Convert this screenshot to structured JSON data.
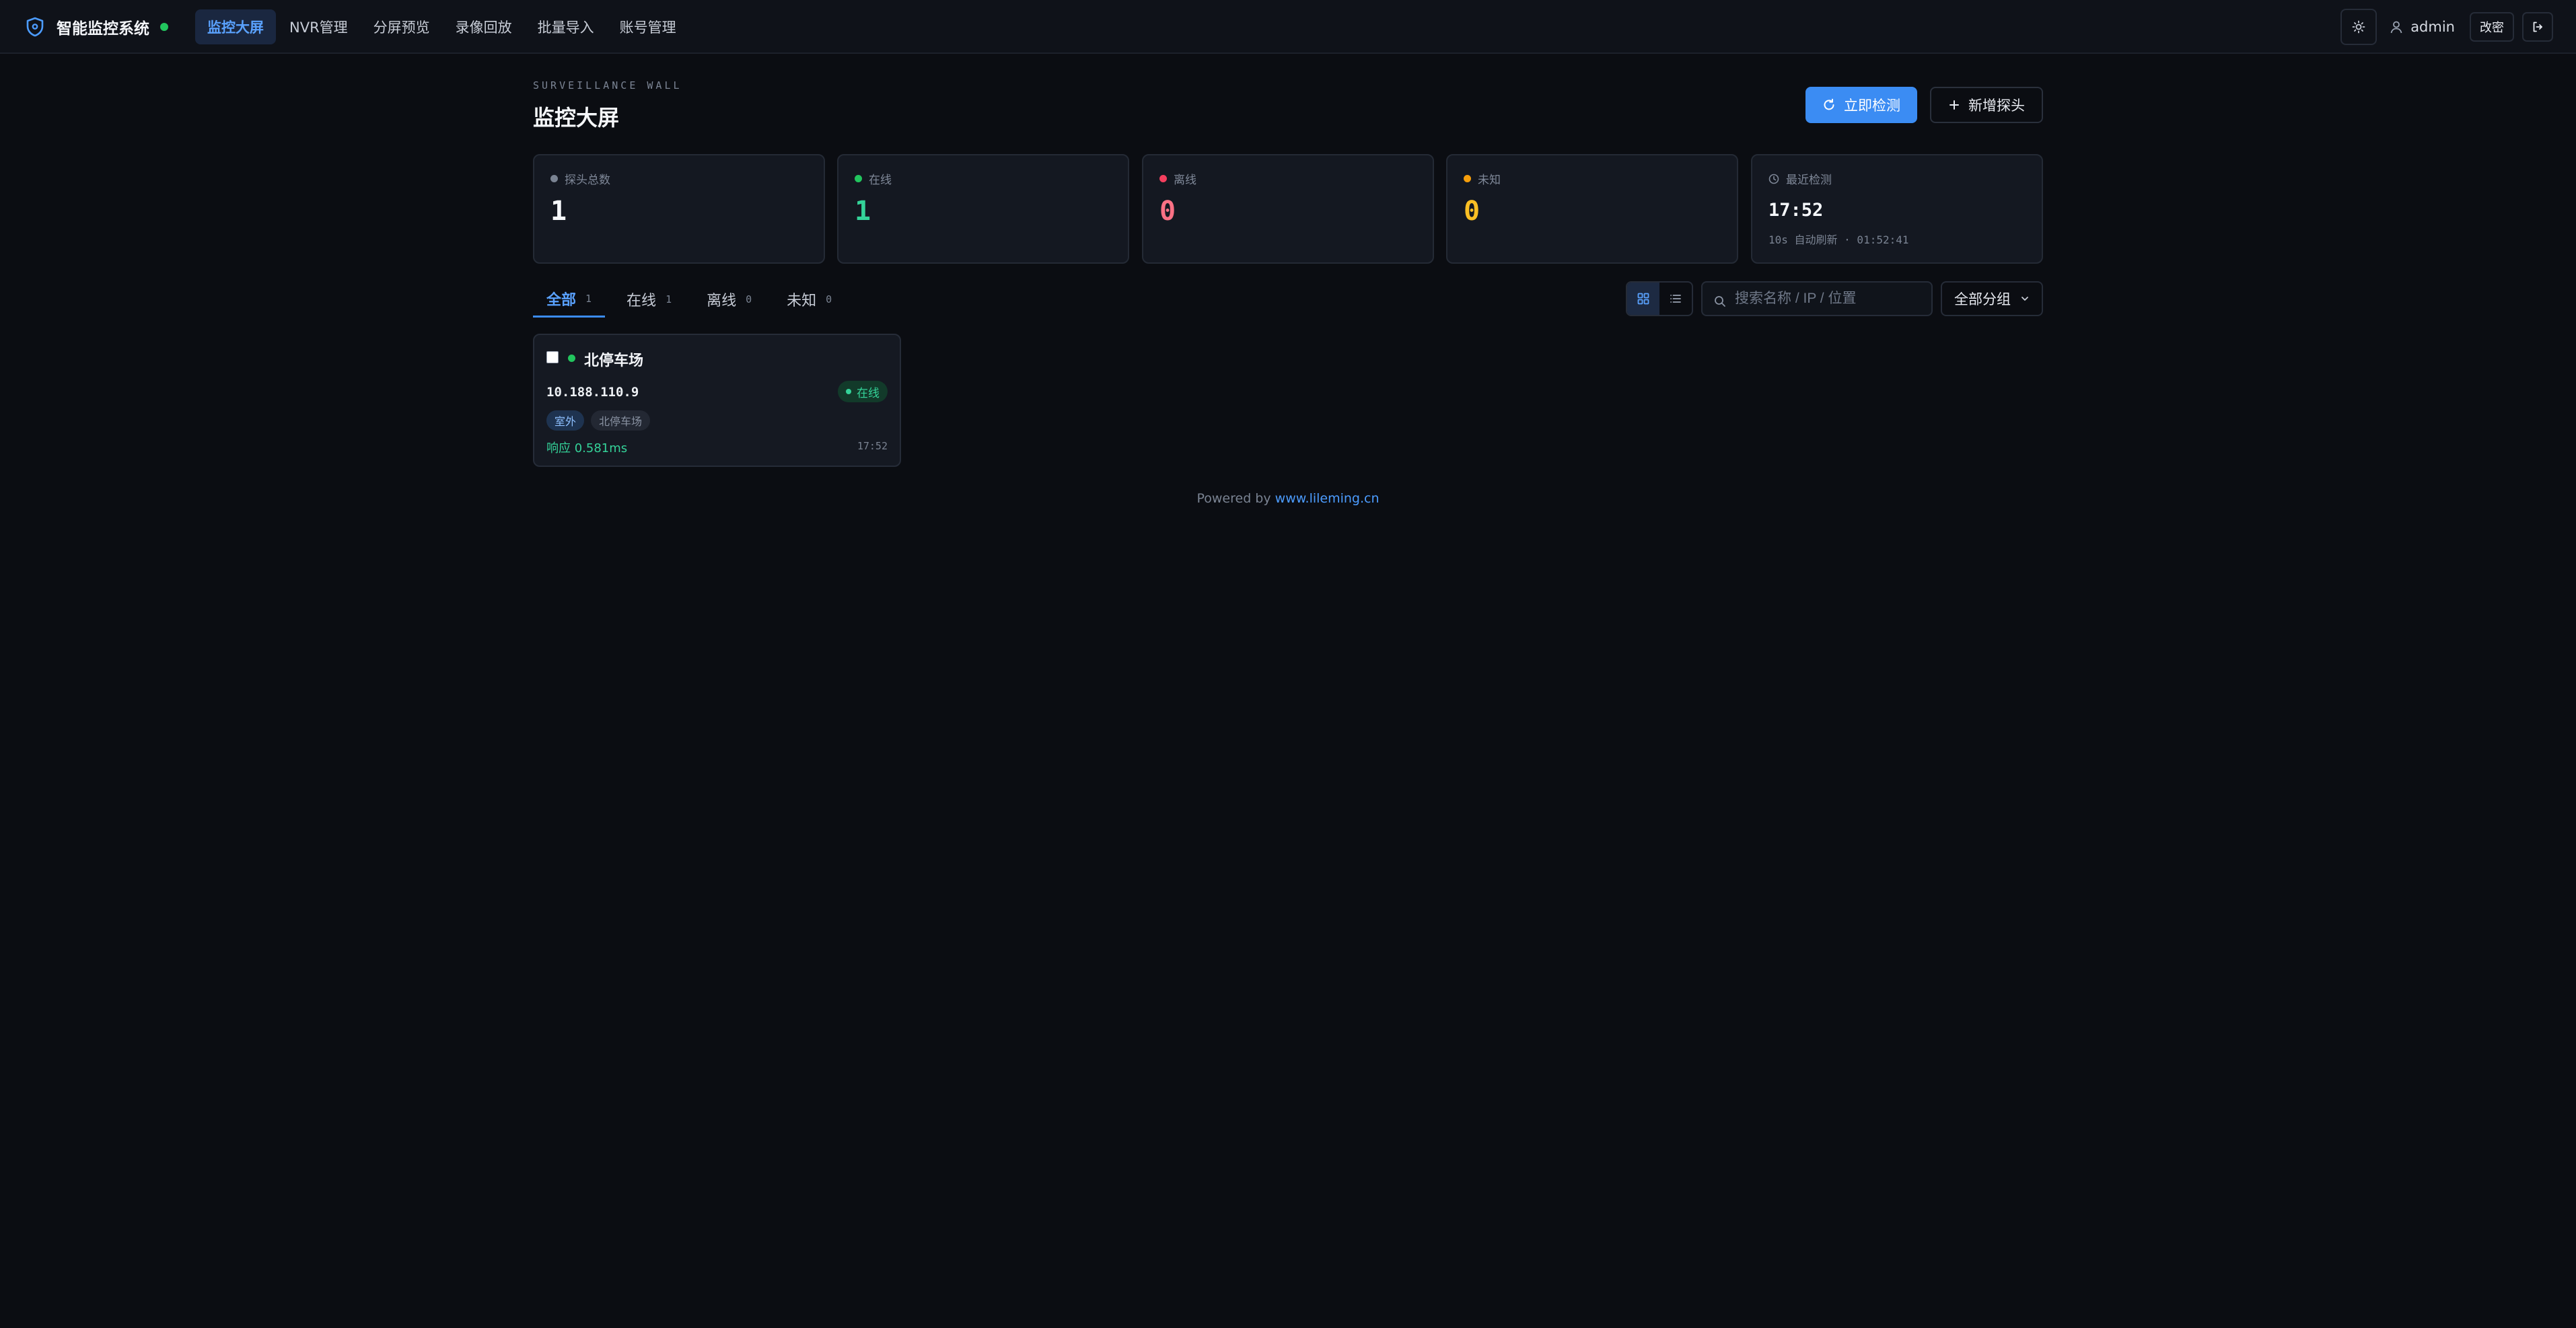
{
  "app": {
    "title": "智能监控系统"
  },
  "nav": {
    "items": [
      {
        "label": "监控大屏",
        "active": true
      },
      {
        "label": "NVR管理"
      },
      {
        "label": "分屏预览"
      },
      {
        "label": "录像回放"
      },
      {
        "label": "批量导入"
      },
      {
        "label": "账号管理"
      }
    ]
  },
  "user": {
    "name": "admin",
    "change_password_label": "改密"
  },
  "header": {
    "eyebrow": "SURVEILLANCE WALL",
    "title": "监控大屏",
    "check_now_label": "立即检测",
    "add_camera_label": "新增探头"
  },
  "stats": {
    "total": {
      "label": "探头总数",
      "value": "1"
    },
    "online": {
      "label": "在线",
      "value": "1"
    },
    "offline": {
      "label": "离线",
      "value": "0"
    },
    "unknown": {
      "label": "未知",
      "value": "0"
    },
    "last_check": {
      "label": "最近检测",
      "time": "17:52",
      "sub": "10s 自动刷新 · 01:52:41"
    }
  },
  "tabs": [
    {
      "label": "全部",
      "count": "1",
      "active": true
    },
    {
      "label": "在线",
      "count": "1"
    },
    {
      "label": "离线",
      "count": "0"
    },
    {
      "label": "未知",
      "count": "0"
    }
  ],
  "search": {
    "placeholder": "搜索名称 / IP / 位置",
    "value": ""
  },
  "group_filter": {
    "selected": "全部分组"
  },
  "cameras": [
    {
      "name": "北停车场",
      "ip": "10.188.110.9",
      "status_label": "在线",
      "tags": [
        "室外",
        "北停车场"
      ],
      "latency": "响应 0.581ms",
      "time": "17:52"
    }
  ],
  "footer": {
    "prefix": "Powered by",
    "link": "www.lileming.cn"
  },
  "colors": {
    "accent": "#3b8cf3",
    "online": "#22c55e",
    "offline": "#f43f5e",
    "unknown": "#f59e0b",
    "background": "#0b0d12"
  }
}
